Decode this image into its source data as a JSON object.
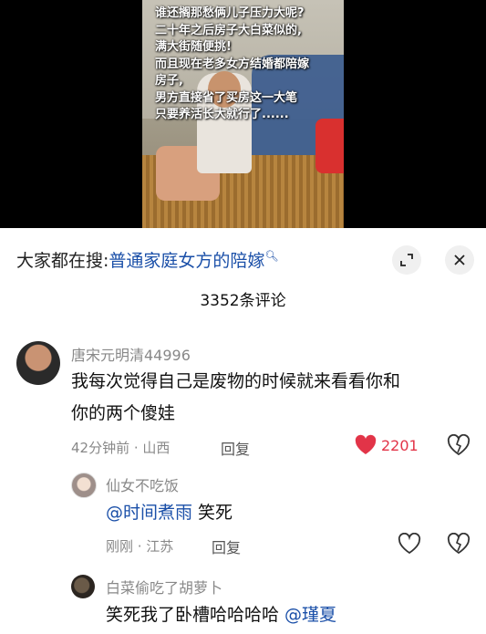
{
  "video": {
    "caption": "谁还搁那愁俩儿子压力大呢?\n二十年之后房子大白菜似的,\n满大街随便挑!\n而且现在老多女方结婚都陪嫁\n房子,\n男方直接省了买房这一大笔\n只要养活长大就行了......"
  },
  "search": {
    "prefix": "大家都在搜:",
    "query": "普通家庭女方的陪嫁"
  },
  "comment_count": "3352条评论",
  "comments": [
    {
      "username": "唐宋元明清44996",
      "line1": "我每次觉得自己是废物的时候就来看看你和",
      "line2": "你的两个傻娃",
      "meta": "42分钟前 · 山西",
      "reply": "回复",
      "likes": "2201"
    }
  ],
  "replies": [
    {
      "username": "仙女不吃饭",
      "mention": "@时间煮雨",
      "text": " 笑死",
      "meta": "刚刚 · 江苏",
      "reply": "回复"
    },
    {
      "username": "白菜偷吃了胡萝卜",
      "text": "笑死我了卧槽哈哈哈哈 ",
      "mention": "@瑾夏"
    }
  ],
  "colors": {
    "accent_blue": "#1a4fa8",
    "like_red": "#e23448"
  },
  "icons": [
    "magnifier-icon",
    "collapse-icon",
    "close-icon",
    "heart-filled-icon",
    "heart-outline-icon",
    "dislike-icon"
  ]
}
